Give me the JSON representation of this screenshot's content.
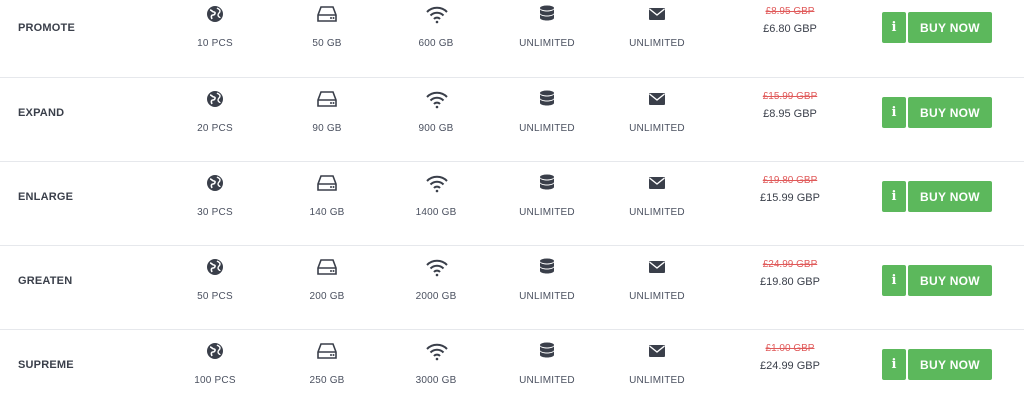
{
  "colors": {
    "accent_green": "#5cb85c",
    "strike_red": "#e05a5a",
    "text_dark": "#3a3f4a",
    "icon_dark": "#3a3f4a"
  },
  "icons": [
    "globe-icon",
    "hard-drive-icon",
    "wifi-icon",
    "database-icon",
    "envelope-icon",
    "info-icon"
  ],
  "button_labels": {
    "buy": "BUY NOW",
    "info": "i"
  },
  "plans": [
    {
      "name": "PROMOTE",
      "features": [
        "10 PCS",
        "50 GB",
        "600 GB",
        "UNLIMITED",
        "UNLIMITED"
      ],
      "old_price": "£8.95 GBP",
      "new_price": "£6.80 GBP"
    },
    {
      "name": "EXPAND",
      "features": [
        "20 PCS",
        "90 GB",
        "900 GB",
        "UNLIMITED",
        "UNLIMITED"
      ],
      "old_price": "£15.99 GBP",
      "new_price": "£8.95 GBP"
    },
    {
      "name": "ENLARGE",
      "features": [
        "30 PCS",
        "140 GB",
        "1400 GB",
        "UNLIMITED",
        "UNLIMITED"
      ],
      "old_price": "£19.80 GBP",
      "new_price": "£15.99 GBP"
    },
    {
      "name": "GREATEN",
      "features": [
        "50 PCS",
        "200 GB",
        "2000 GB",
        "UNLIMITED",
        "UNLIMITED"
      ],
      "old_price": "£24.99 GBP",
      "new_price": "£19.80 GBP"
    },
    {
      "name": "SUPREME",
      "features": [
        "100 PCS",
        "250 GB",
        "3000 GB",
        "UNLIMITED",
        "UNLIMITED"
      ],
      "old_price": "£1.00 GBP",
      "new_price": "£24.99 GBP"
    }
  ]
}
